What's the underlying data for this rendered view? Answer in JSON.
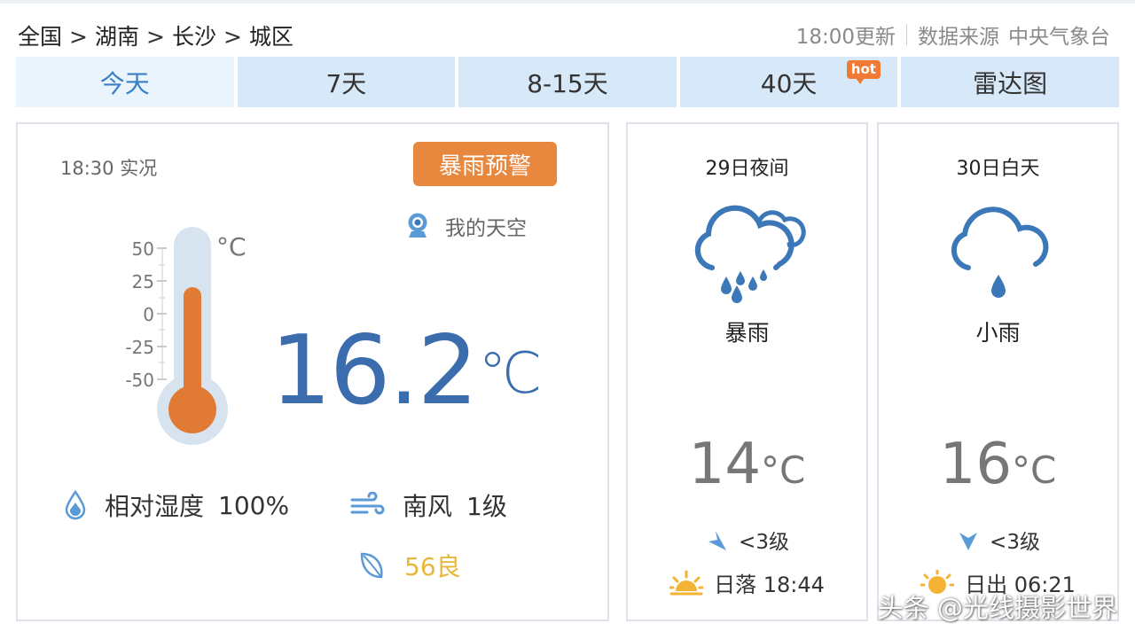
{
  "breadcrumb": {
    "items": [
      "全国",
      "湖南",
      "长沙",
      "城区"
    ],
    "separator": ">"
  },
  "update": {
    "time_text": "18:00更新",
    "source_label": "数据来源",
    "source_name": "中央气象台"
  },
  "tabs": [
    {
      "label": "今天",
      "active": true
    },
    {
      "label": "7天"
    },
    {
      "label": "8-15天"
    },
    {
      "label": "40天",
      "badge": "hot"
    },
    {
      "label": "雷达图"
    }
  ],
  "current": {
    "obs_time": "18:30 实况",
    "warning_label": "暴雨预警",
    "mysky_label": "我的天空",
    "thermometer": {
      "unit": "°C",
      "ticks": [
        "50",
        "25",
        "0",
        "-25",
        "-50"
      ]
    },
    "temperature": "16.2",
    "temperature_unit": "℃",
    "humidity_label": "相对湿度",
    "humidity_value": "100%",
    "wind_direction": "南风",
    "wind_level": "1级",
    "aqi_text": "56良"
  },
  "forecast": [
    {
      "title": "29日夜间",
      "icon": "heavy-rain-icon",
      "desc": "暴雨",
      "temp": "14",
      "unit": "°C",
      "wind": "<3级",
      "sun_text": "日落 18:44"
    },
    {
      "title": "30日白天",
      "icon": "light-rain-icon",
      "desc": "小雨",
      "temp": "16",
      "unit": "°C",
      "wind": "<3级",
      "sun_text": "日出 06:21"
    }
  ],
  "watermark": "头条 @光线摄影世界",
  "colors": {
    "accent_blue": "#3b6cae",
    "tab_bg": "#d7e9f9",
    "warning_orange": "#e8873e",
    "mercury": "#e07a34",
    "aqi_yellow": "#e8b73a",
    "icon_blue": "#3c78b8"
  }
}
